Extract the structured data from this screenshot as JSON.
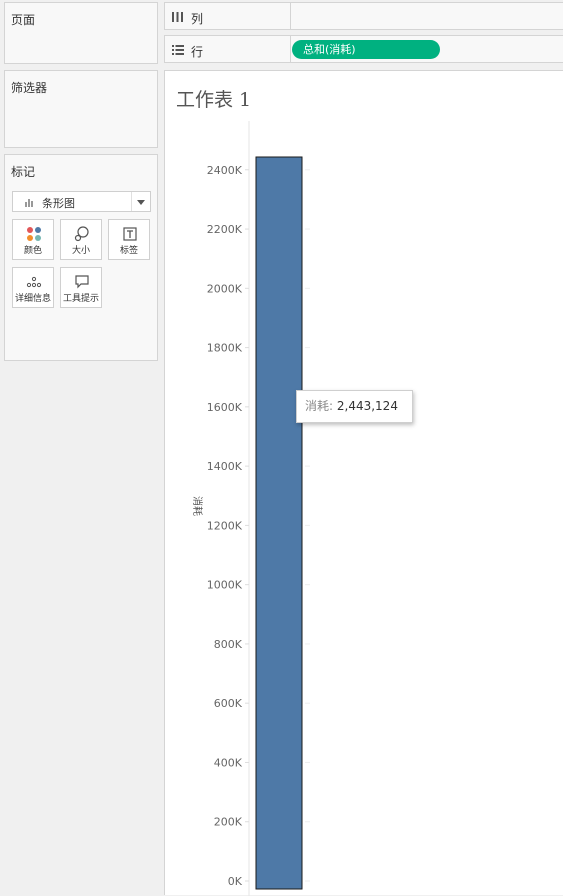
{
  "panels": {
    "pages_title": "页面",
    "filters_title": "筛选器",
    "marks_title": "标记"
  },
  "marks": {
    "type_label": "条形图",
    "buttons": [
      {
        "label": "颜色",
        "icon": "color-icon"
      },
      {
        "label": "大小",
        "icon": "size-icon"
      },
      {
        "label": "标签",
        "icon": "label-icon"
      },
      {
        "label": "详细信息",
        "icon": "detail-icon"
      },
      {
        "label": "工具提示",
        "icon": "tooltip-icon"
      }
    ]
  },
  "shelves": {
    "columns_label": "列",
    "rows_label": "行",
    "rows_pill": "总和(消耗)"
  },
  "worksheet": {
    "title": "工作表 1"
  },
  "tooltip": {
    "key": "消耗:",
    "value": "2,443,124"
  },
  "colors": {
    "bar": "#4e79a7",
    "pill": "#00b180"
  },
  "chart_data": {
    "type": "bar",
    "categories": [
      ""
    ],
    "values": [
      2443124
    ],
    "ylabel": "消耗",
    "ylim": [
      0,
      2443124
    ],
    "yticks": [
      0,
      200000,
      400000,
      600000,
      800000,
      1000000,
      1200000,
      1400000,
      1600000,
      1800000,
      2000000,
      2200000,
      2400000
    ],
    "ytick_labels": [
      "0K",
      "200K",
      "400K",
      "600K",
      "800K",
      "1000K",
      "1200K",
      "1400K",
      "1600K",
      "1800K",
      "2000K",
      "2200K",
      "2400K"
    ],
    "grid": false
  }
}
